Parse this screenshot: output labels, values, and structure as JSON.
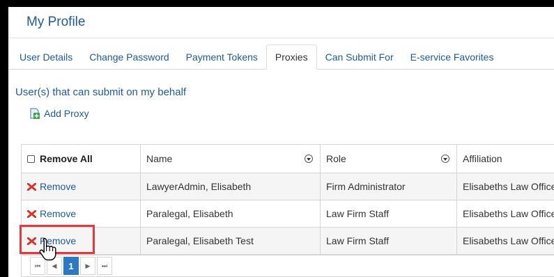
{
  "header": {
    "title": "My Profile"
  },
  "tabs": [
    {
      "label": "User Details",
      "active": false
    },
    {
      "label": "Change Password",
      "active": false
    },
    {
      "label": "Payment Tokens",
      "active": false
    },
    {
      "label": "Proxies",
      "active": true
    },
    {
      "label": "Can Submit For",
      "active": false
    },
    {
      "label": "E-service Favorites",
      "active": false
    }
  ],
  "section": {
    "title": "User(s) that can submit on my behalf"
  },
  "toolbar": {
    "add_label": "Add Proxy"
  },
  "grid": {
    "columns": [
      "Remove All",
      "Name",
      "Role",
      "Affiliation"
    ],
    "rows": [
      {
        "action": "Remove",
        "name": "LawyerAdmin, Elisabeth",
        "role": "Firm Administrator",
        "affiliation": "Elisabeths Law Office"
      },
      {
        "action": "Remove",
        "name": "Paralegal, Elisabeth",
        "role": "Law Firm Staff",
        "affiliation": "Elisabeths Law Office"
      },
      {
        "action": "Remove",
        "name": "Paralegal, Elisabeth Test",
        "role": "Law Firm Staff",
        "affiliation": "Elisabeths Law Office"
      }
    ]
  },
  "pager": {
    "first": "⏮",
    "prev": "◀",
    "current": "1",
    "next": "▶",
    "last": "⏭"
  },
  "colors": {
    "link": "#1f5a96",
    "accent": "#2b78c4",
    "highlight": "#e0393e",
    "remove_icon": "#d9342b"
  },
  "icons": {
    "add": "add-document-icon",
    "remove": "red-x-icon",
    "filter": "filter-icon",
    "cursor": "hand-pointer-icon"
  }
}
